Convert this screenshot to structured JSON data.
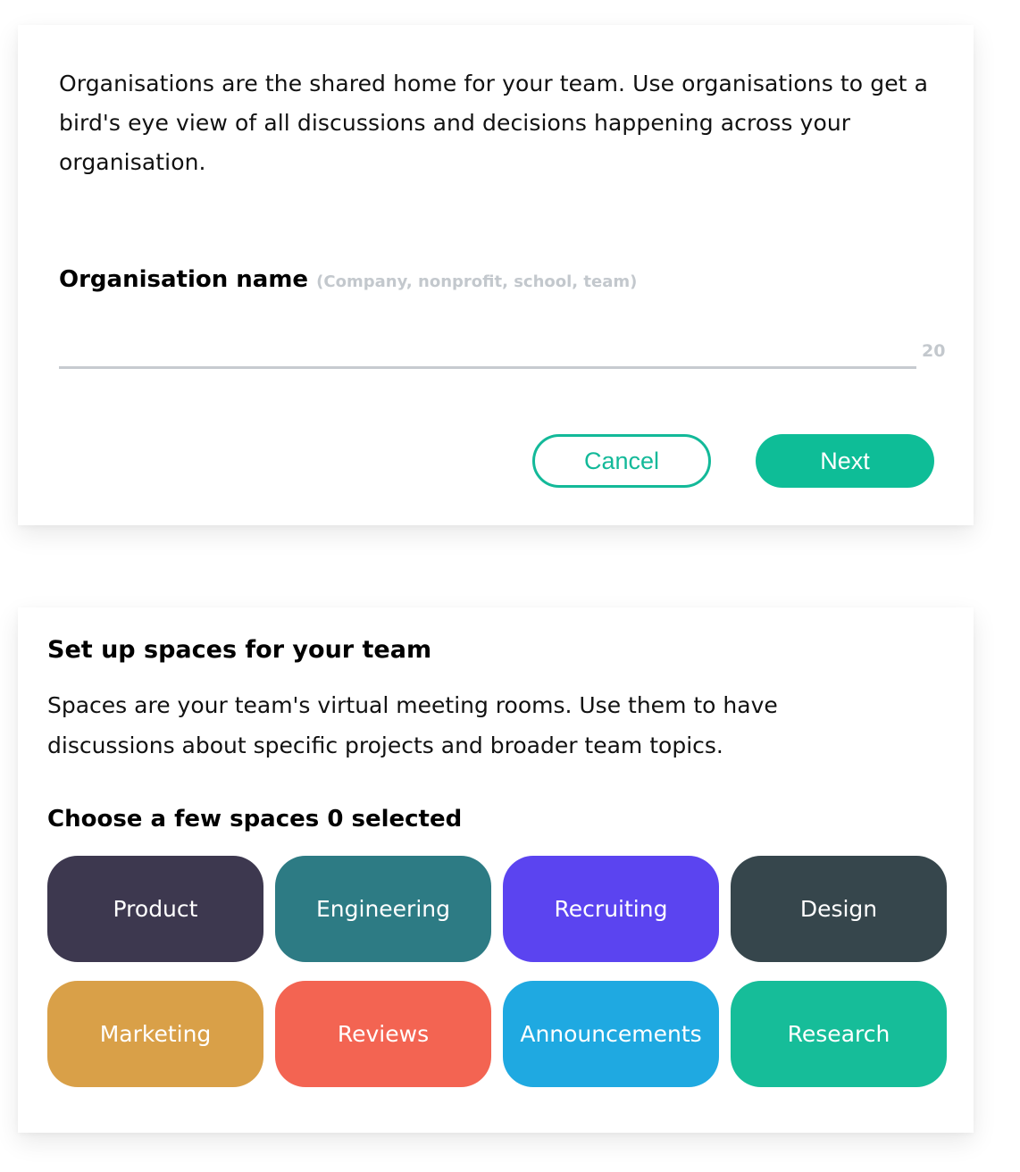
{
  "org_form": {
    "intro": "Organisations are the shared home for your team. Use organisations to get a bird's eye view of all discussions and decisions happening across your organisation.",
    "field_label": "Organisation name",
    "field_hint": "(Company, nonprofit, school, team)",
    "input_value": "",
    "char_remaining": "20",
    "cancel_label": "Cancel",
    "next_label": "Next",
    "accent_color": "#13b999"
  },
  "spaces": {
    "title": "Set up spaces for your team",
    "description": "Spaces are your team's virtual meeting rooms. Use them to have discussions about specific projects and broader team topics.",
    "choose_label": "Choose a few spaces",
    "selected_count": "0",
    "selected_suffix": "selected",
    "items": [
      {
        "label": "Product",
        "color": "#3d384f"
      },
      {
        "label": "Engineering",
        "color": "#2d7b84"
      },
      {
        "label": "Recruiting",
        "color": "#5b44f0"
      },
      {
        "label": "Design",
        "color": "#36464c"
      },
      {
        "label": "Marketing",
        "color": "#d9a048"
      },
      {
        "label": "Reviews",
        "color": "#f36452"
      },
      {
        "label": "Announcements",
        "color": "#1fa9e1"
      },
      {
        "label": "Research",
        "color": "#16bd99"
      }
    ]
  }
}
